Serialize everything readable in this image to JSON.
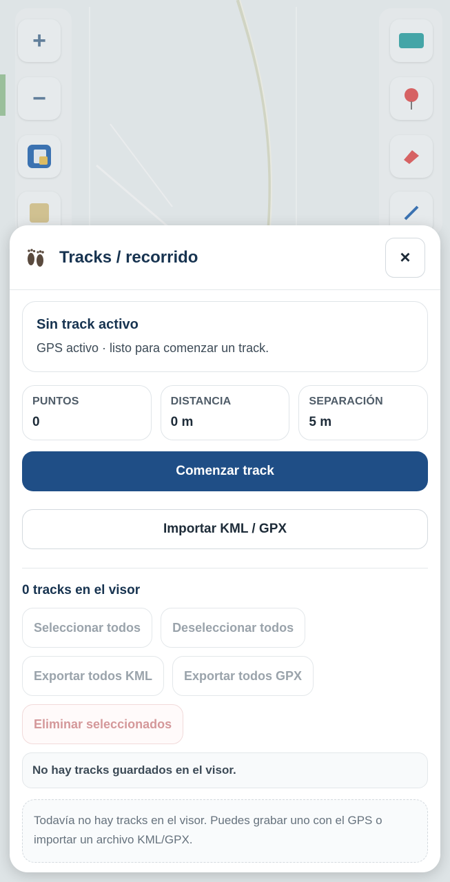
{
  "panel": {
    "title": "Tracks / recorrido",
    "icon": "footprints-icon",
    "close_label": "×"
  },
  "status": {
    "title": "Sin track activo",
    "description": "GPS activo · listo para comenzar un track."
  },
  "stats": [
    {
      "label": "PUNTOS",
      "value": "0"
    },
    {
      "label": "DISTANCIA",
      "value": "0 m"
    },
    {
      "label": "SEPARACIÓN",
      "value": "5 m"
    }
  ],
  "buttons": {
    "start": "Comenzar track",
    "import": "Importar KML / GPX"
  },
  "tracks": {
    "count_label": "0 tracks en el visor",
    "select_all": "Seleccionar todos",
    "deselect_all": "Deseleccionar todos",
    "export_kml": "Exportar todos KML",
    "export_gpx": "Exportar todos GPX",
    "delete_selected": "Eliminar seleccionados",
    "empty_message": "No hay tracks guardados en el visor.",
    "hint": "Todavía no hay tracks en el visor. Puedes grabar uno con el GPS o importar un archivo KML/GPX."
  },
  "map_controls": {
    "zoom_in": "+",
    "zoom_out": "−",
    "icons": [
      "zoom-in-icon",
      "zoom-out-icon",
      "layers-icon",
      "legend-icon",
      "basemap-icon",
      "marker-icon",
      "pin-icon",
      "draw-icon"
    ]
  },
  "colors": {
    "primary": "#1f4e86",
    "title": "#173350",
    "danger_text": "#d4989a"
  }
}
